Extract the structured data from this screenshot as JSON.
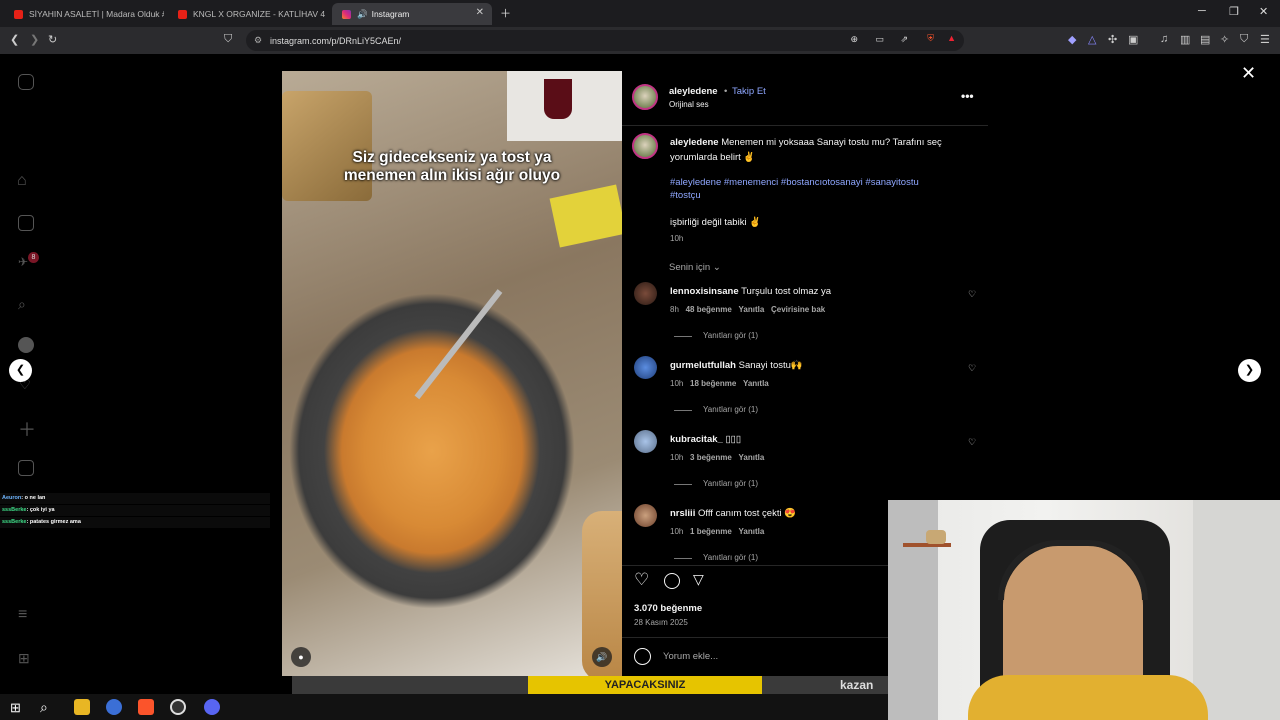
{
  "browser": {
    "tabs": [
      {
        "label": "SİYAHIN ASALETİ | Madara Olduk #6"
      },
      {
        "label": "KNGL X ORGANİZE - KATLİHAV 4 (OF"
      },
      {
        "label": "Instagram"
      }
    ],
    "url": "instagram.com/p/DRnLiY5CAEn/"
  },
  "video": {
    "caption_line1": "Siz gidecekseniz ya tost ya",
    "caption_line2": "menemen alın ikisi ağır oluyo"
  },
  "post": {
    "username": "aleyledene",
    "follow_label": "Takip Et",
    "audio": "Orijinal ses",
    "caption_text": "Menemen mi yoksaaa Sanayi tostu mu? Tarafını seç",
    "caption_text2": "yorumlarda belirt ✌",
    "hashtags1": "#aleyledene #menemenci #bostancıotosanayi #sanayitostu",
    "hashtags2": "#tostçu",
    "collab": "işbirliği değil tabiki ✌",
    "time": "10h",
    "sort_label": "Senin için",
    "likes": "3.070 beğenme",
    "date": "28 Kasım 2025",
    "comment_placeholder": "Yorum ekle..."
  },
  "comments": [
    {
      "user": "lennoxisinsane",
      "text": "Turşulu tost olmaz ya",
      "time": "8h",
      "likes": "48 beğenme",
      "reply": "Yanıtla",
      "translate": "Çevirisine bak",
      "view_replies": "Yanıtları gör (1)"
    },
    {
      "user": "gurmelutfullah",
      "text": "Sanayi tostu🙌",
      "time": "10h",
      "likes": "18 beğenme",
      "reply": "Yanıtla",
      "view_replies": "Yanıtları gör (1)"
    },
    {
      "user": "kubracitak_",
      "text": "▯▯▯",
      "time": "10h",
      "likes": "3 beğenme",
      "reply": "Yanıtla",
      "view_replies": "Yanıtları gör (1)"
    },
    {
      "user": "nrsliii",
      "text": "Offf canım tost çekti 😍",
      "time": "10h",
      "likes": "1 beğenme",
      "reply": "Yanıtla",
      "view_replies": "Yanıtları gör (1)"
    }
  ],
  "chat_overlay": [
    {
      "user": "Aeuron",
      "text": ": o ne lan"
    },
    {
      "user": "sssBerke",
      "text": ": çok iyi ya"
    },
    {
      "user": "sssBerke",
      "text": ": patates girmez ama"
    }
  ],
  "notification_badge": "8",
  "background_text": {
    "sign": "YAPACAKSINIZ",
    "brand": "kazan"
  },
  "colors": {
    "accent": "#8fa7ff",
    "ring": "#c13584",
    "panel": "#000000"
  }
}
